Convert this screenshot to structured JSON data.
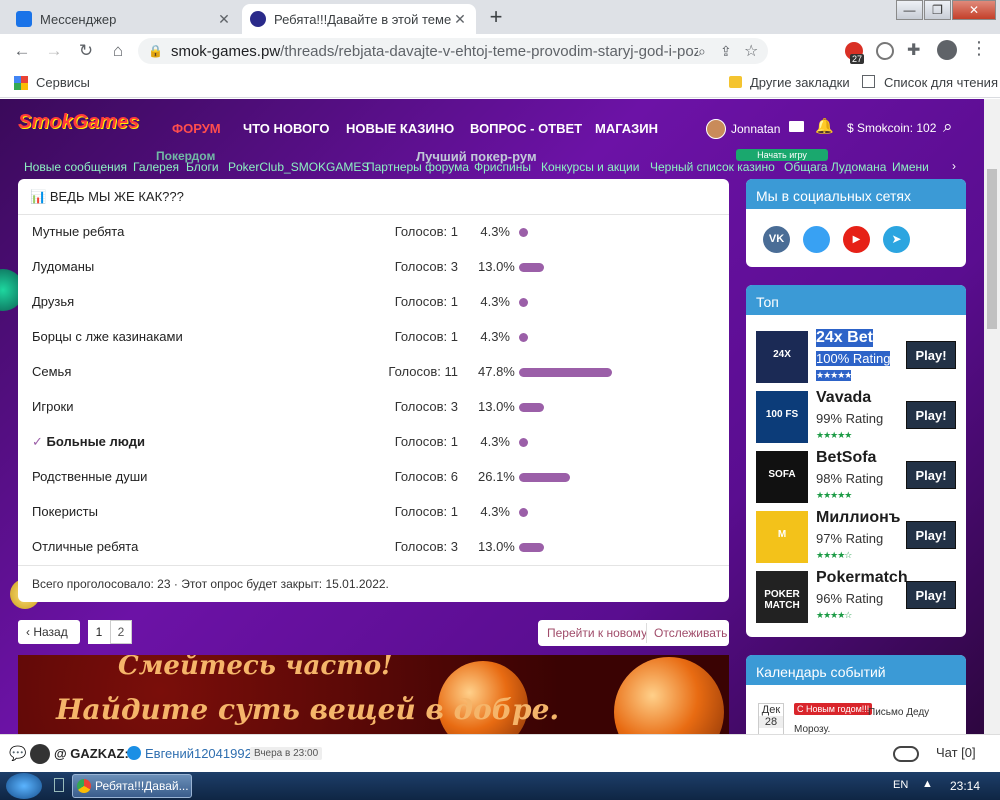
{
  "browser": {
    "tabs": [
      {
        "title": "Мессенджер"
      },
      {
        "title": "Ребята!!!Давайте в этой теме!!!Г"
      }
    ],
    "url_host": "smok-games.pw",
    "url_path": "/threads/rebjata-davajte-v-ehtoj-teme-provodim-staryj-god-i-pozhelaem-...",
    "bookmarks": {
      "services": "Сервисы",
      "other": "Другие закладки",
      "reading_list": "Список для чтения"
    },
    "ext_badge": "27"
  },
  "site": {
    "logo": "SmokGames",
    "nav": [
      "ФОРУМ",
      "ЧТО НОВОГО",
      "НОВЫЕ КАЗИНО",
      "ВОПРОС - ОТВЕТ",
      "МАГАЗИН"
    ],
    "user": "Jonnatan",
    "coins": "$ Smokcoin: 102",
    "subnav": [
      "Новые сообщения",
      "Галерея",
      "Блоги",
      "PokerClub_SMOKGAMES",
      "Партнеры форума",
      "Фриспины",
      "Конкурсы и акции",
      "Черный список казино",
      "Общага Лудомана",
      "Имени"
    ],
    "banner_text": "Лучший покер-рум",
    "banner_brand": "Покердом",
    "banner_btn": "Начать игру"
  },
  "poll": {
    "title": "ВЕДЬ МЫ ЖЕ КАК???",
    "options": [
      {
        "label": "Мутные ребята",
        "votes": "Голосов: 1",
        "pct": "4.3%",
        "value": 4.3,
        "voted": false
      },
      {
        "label": "Лудоманы",
        "votes": "Голосов: 3",
        "pct": "13.0%",
        "value": 13.0,
        "voted": false
      },
      {
        "label": "Друзья",
        "votes": "Голосов: 1",
        "pct": "4.3%",
        "value": 4.3,
        "voted": false
      },
      {
        "label": "Борцы с лже казинаками",
        "votes": "Голосов: 1",
        "pct": "4.3%",
        "value": 4.3,
        "voted": false
      },
      {
        "label": "Семья",
        "votes": "Голосов: 11",
        "pct": "47.8%",
        "value": 47.8,
        "voted": false
      },
      {
        "label": "Игроки",
        "votes": "Голосов: 3",
        "pct": "13.0%",
        "value": 13.0,
        "voted": false
      },
      {
        "label": "Больные люди",
        "votes": "Голосов: 1",
        "pct": "4.3%",
        "value": 4.3,
        "voted": true
      },
      {
        "label": "Родственные души",
        "votes": "Голосов: 6",
        "pct": "26.1%",
        "value": 26.1,
        "voted": false
      },
      {
        "label": "Покеристы",
        "votes": "Голосов: 1",
        "pct": "4.3%",
        "value": 4.3,
        "voted": false
      },
      {
        "label": "Отличные ребята",
        "votes": "Голосов: 3",
        "pct": "13.0%",
        "value": 13.0,
        "voted": false
      }
    ],
    "footer": "Всего проголосовало: 23 · Этот опрос будет закрыт: 15.01.2022."
  },
  "pagination": {
    "back": "Назад",
    "pages": [
      "1",
      "2"
    ],
    "goto_new": "Перейти к новому",
    "watch": "Отслеживать"
  },
  "image_text": {
    "line1": "Смейтесь часто!",
    "line2": "Найдите суть вещей в добре."
  },
  "sidebar": {
    "social_title": "Мы в социальных сетях",
    "top_title": "Топ",
    "top": [
      {
        "name": "24x Bet",
        "rating": "100% Rating",
        "stars": "★★★★★",
        "play": "Play!",
        "logo": "24X",
        "color": "#1b2a55"
      },
      {
        "name": "Vavada",
        "rating": "99% Rating",
        "stars": "★★★★★",
        "play": "Play!",
        "logo": "100 FS",
        "color": "#0c3c79"
      },
      {
        "name": "BetSofa",
        "rating": "98% Rating",
        "stars": "★★★★★",
        "play": "Play!",
        "logo": "SOFA",
        "color": "#111111"
      },
      {
        "name": "Миллионъ",
        "rating": "97% Rating",
        "stars": "★★★★☆",
        "play": "Play!",
        "logo": "М",
        "color": "#f3c21a"
      },
      {
        "name": "Pokermatch",
        "rating": "96% Rating",
        "stars": "★★★★☆",
        "play": "Play!",
        "logo": "POKER MATCH",
        "color": "#222222"
      }
    ],
    "calendar_title": "Календарь событий",
    "cal_month": "Дек",
    "cal_day": "28",
    "cal_badge": "С Новым годом!!!",
    "cal_text": "Письмо Деду Морозу."
  },
  "chat": {
    "user1": "@ GAZKAZ:",
    "user2": "Евгений12041992",
    "time": "Вчера в 23:00",
    "chat_label": "Чат [0]"
  },
  "taskbar": {
    "window": "Ребята!!!Давай...",
    "lang": "EN",
    "clock": "23:14"
  }
}
